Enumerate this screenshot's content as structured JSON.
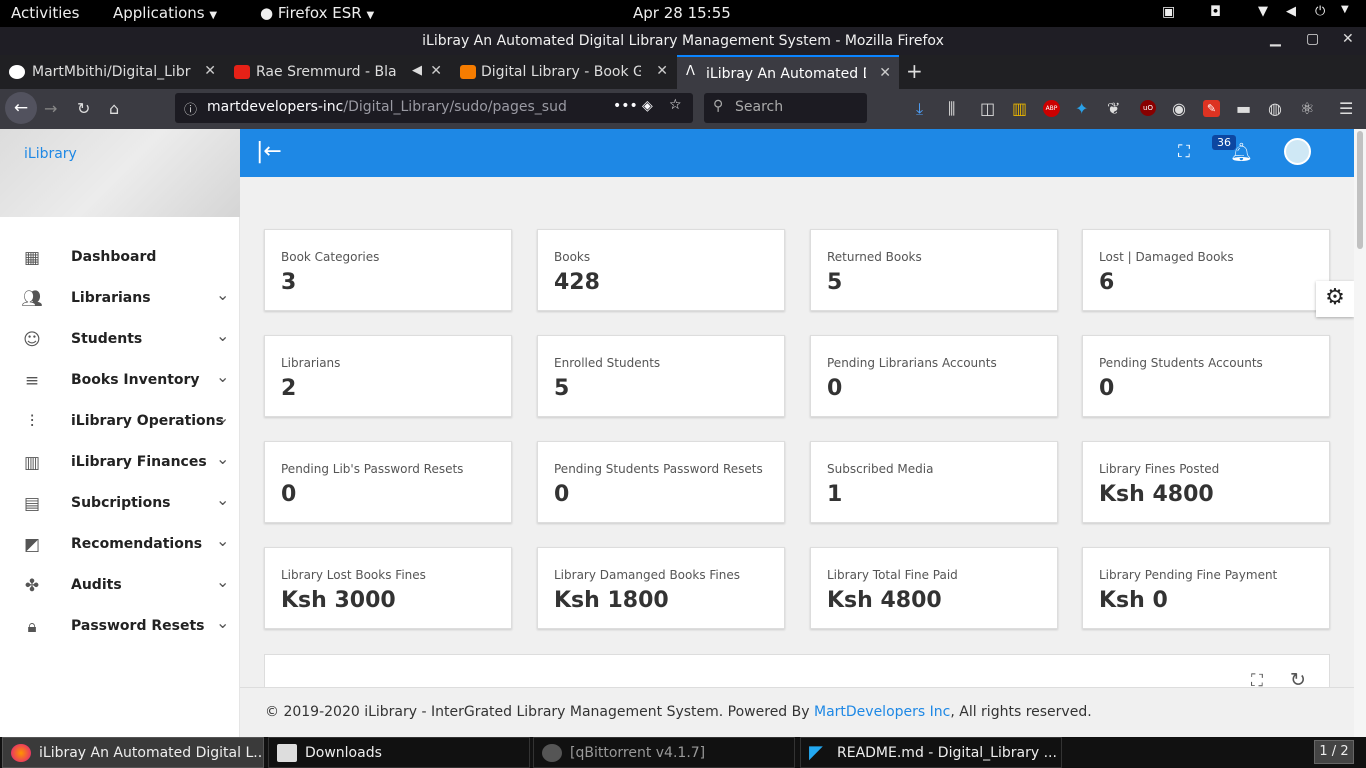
{
  "topbar": {
    "activities": "Activities",
    "applications": "Applications",
    "firefox": "Firefox ESR",
    "datetime": "Apr 28  15:55"
  },
  "window": {
    "title": "iLibray An Automated Digital Library Management System - Mozilla Firefox"
  },
  "tabs": [
    {
      "label": "MartMbithi/Digital_Libr"
    },
    {
      "label": "Rae Sremmurd - Bla"
    },
    {
      "label": "Digital Library - Book Gu"
    },
    {
      "label": "iLibray An Automated D"
    }
  ],
  "navbar": {
    "url_host": "martdevelopers-inc",
    "url_path": "/Digital_Library/sudo/pages_sud",
    "search_placeholder": "Search"
  },
  "sidebar": {
    "brand": "iLibrary",
    "items": [
      {
        "label": "Dashboard",
        "icon": "dashboard-icon"
      },
      {
        "label": "Librarians",
        "icon": "people-icon"
      },
      {
        "label": "Students",
        "icon": "face-icon"
      },
      {
        "label": "Books Inventory",
        "icon": "list-icon"
      },
      {
        "label": "iLibrary Operations",
        "icon": "equalizer-icon"
      },
      {
        "label": "iLibrary Finances",
        "icon": "barcode-icon"
      },
      {
        "label": "Subcriptions",
        "icon": "view-quilt-icon"
      },
      {
        "label": "Recomendations",
        "icon": "widgets-icon"
      },
      {
        "label": "Audits",
        "icon": "extension-icon"
      },
      {
        "label": "Password Resets",
        "icon": "lock-icon"
      }
    ]
  },
  "appbar": {
    "notification_count": "36"
  },
  "cards": [
    {
      "label": "Book Categories",
      "value": "3"
    },
    {
      "label": "Books",
      "value": "428"
    },
    {
      "label": "Returned Books",
      "value": "5"
    },
    {
      "label": "Lost | Damaged Books",
      "value": "6"
    },
    {
      "label": "Librarians",
      "value": "2"
    },
    {
      "label": "Enrolled Students",
      "value": "5"
    },
    {
      "label": "Pending Librarians Accounts",
      "value": "0"
    },
    {
      "label": "Pending Students Accounts",
      "value": "0"
    },
    {
      "label": "Pending Lib's Password Resets",
      "value": "0"
    },
    {
      "label": "Pending Students Password Resets",
      "value": "0"
    },
    {
      "label": "Subscribed Media",
      "value": "1"
    },
    {
      "label": "Library Fines Posted",
      "value": "Ksh 4800"
    },
    {
      "label": "Library Lost Books Fines",
      "value": "Ksh 3000"
    },
    {
      "label": "Library Damanged Books Fines",
      "value": "Ksh 1800"
    },
    {
      "label": "Library Total Fine Paid",
      "value": "Ksh 4800"
    },
    {
      "label": "Library Pending Fine Payment",
      "value": "Ksh 0"
    }
  ],
  "footer": {
    "prefix": "© 2019-2020 iLibrary - InterGrated Library Management System. Powered By ",
    "link": "MartDevelopers Inc",
    "suffix": ", All rights reserved."
  },
  "taskbar": {
    "items": [
      {
        "label": "iLibray An Automated Digital L..."
      },
      {
        "label": "Downloads"
      },
      {
        "label": "[qBittorrent v4.1.7]"
      },
      {
        "label": "README.md - Digital_Library ..."
      }
    ],
    "workspace": "1 / 2"
  },
  "colors": {
    "accent": "#1e88e5",
    "brand": "#1e88e5"
  }
}
